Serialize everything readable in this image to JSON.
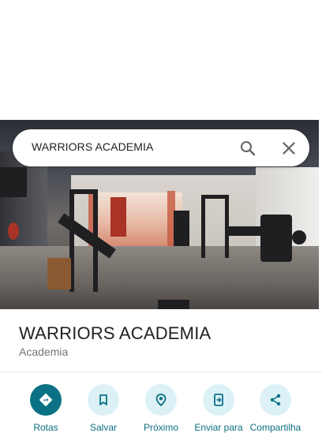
{
  "search": {
    "query": "WARRIORS ACADEMIA"
  },
  "place": {
    "name": "WARRIORS ACADEMIA",
    "category": "Academia"
  },
  "actions": [
    {
      "label": "Rotas",
      "icon": "directions-icon"
    },
    {
      "label": "Salvar",
      "icon": "bookmark-icon"
    },
    {
      "label": "Próximo",
      "icon": "nearby-icon"
    },
    {
      "label": "Enviar para",
      "icon": "send-to-phone-icon"
    },
    {
      "label": "Compartilha",
      "icon": "share-icon"
    }
  ],
  "colors": {
    "accent": "#0b7285",
    "accent_light": "#dcf1f6",
    "label": "#0b6e80"
  }
}
